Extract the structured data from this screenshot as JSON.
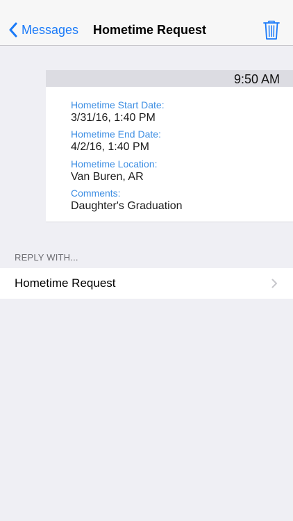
{
  "navbar": {
    "back_label": "Messages",
    "title": "Hometime Request",
    "trash_icon": "trash-icon",
    "accent_color": "#1a7af8"
  },
  "message": {
    "time": "9:50 AM",
    "fields": [
      {
        "label": "Hometime Start Date:",
        "value": "3/31/16, 1:40 PM"
      },
      {
        "label": "Hometime End Date:",
        "value": "4/2/16, 1:40 PM"
      },
      {
        "label": "Hometime Location:",
        "value": "Van Buren, AR"
      },
      {
        "label": "Comments:",
        "value": "Daughter's Graduation"
      }
    ]
  },
  "reply": {
    "section_header": "REPLY WITH...",
    "options": [
      {
        "label": "Hometime Request"
      }
    ]
  }
}
